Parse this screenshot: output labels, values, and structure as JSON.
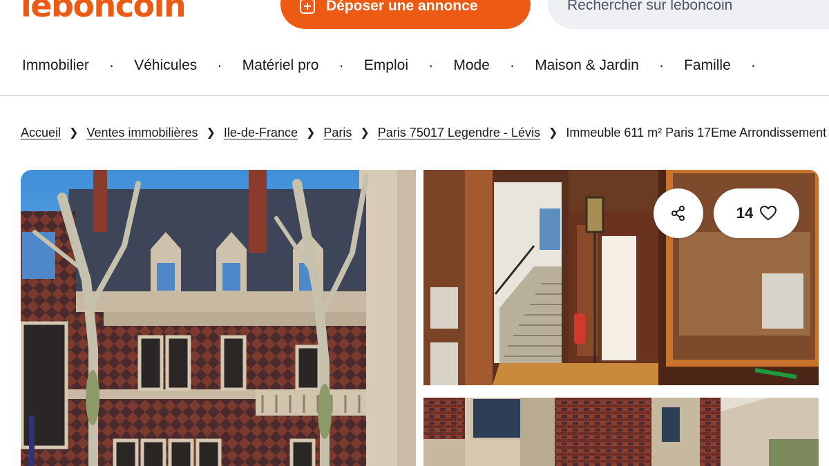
{
  "header": {
    "logo": "leboncoin",
    "post_button_label": "Déposer une annonce",
    "search_placeholder": "Rechercher sur leboncoin"
  },
  "nav": {
    "items": [
      "Immobilier",
      "Véhicules",
      "Matériel pro",
      "Emploi",
      "Mode",
      "Maison & Jardin",
      "Famille"
    ],
    "separator": "·"
  },
  "breadcrumb": {
    "items": [
      "Accueil",
      "Ventes immobilières",
      "Ile-de-France",
      "Paris",
      "Paris 75017 Legendre - Lévis"
    ],
    "current": "Immeuble 611 m² Paris 17Eme Arrondissement"
  },
  "gallery": {
    "favorites_count": "14"
  },
  "colors": {
    "brand": "#ec5a13",
    "search_bg": "#eef0f4",
    "text": "#1a1a1a"
  },
  "icons": {
    "post": "plus-square-icon",
    "share": "share-icon",
    "favorite": "heart-icon",
    "breadcrumb_separator": "chevron-right-icon"
  }
}
